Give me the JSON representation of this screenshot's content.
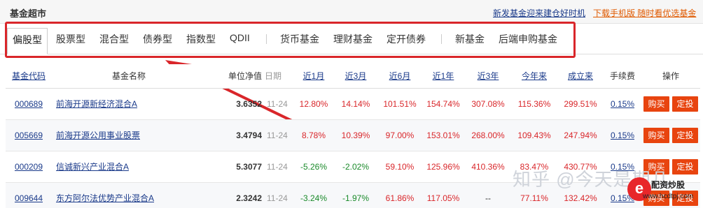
{
  "header": {
    "title": "基金超市",
    "link_new_fund": "新发基金迎来建仓好时机",
    "link_app": "下载手机版 随时看优选基金"
  },
  "tabs": [
    {
      "label": "偏股型"
    },
    {
      "label": "股票型"
    },
    {
      "label": "混合型"
    },
    {
      "label": "债券型"
    },
    {
      "label": "指数型"
    },
    {
      "label": "QDII"
    },
    {
      "label": "货币基金"
    },
    {
      "label": "理财基金"
    },
    {
      "label": "定开债券"
    },
    {
      "label": "新基金"
    },
    {
      "label": "后端申购基金"
    }
  ],
  "table": {
    "headers": {
      "code": "基金代码",
      "name": "基金名称",
      "nav": "单位净值",
      "date": "日期",
      "m1": "近1月",
      "m3": "近3月",
      "m6": "近6月",
      "y1": "近1年",
      "y3": "近3年",
      "ytd": "今年来",
      "since": "成立来",
      "fee": "手续费",
      "ops": "操作"
    },
    "rows": [
      {
        "code": "000689",
        "name": "前海开源新经济混合A",
        "nav": "3.6352",
        "date": "11-24",
        "m1": "12.80%",
        "m3": "14.14%",
        "m6": "101.51%",
        "y1": "154.74%",
        "y3": "307.08%",
        "ytd": "115.36%",
        "since": "299.51%",
        "fee": "0.15%"
      },
      {
        "code": "005669",
        "name": "前海开源公用事业股票",
        "nav": "3.4794",
        "date": "11-24",
        "m1": "8.78%",
        "m3": "10.39%",
        "m6": "97.00%",
        "y1": "153.01%",
        "y3": "268.00%",
        "ytd": "109.43%",
        "since": "247.94%",
        "fee": "0.15%"
      },
      {
        "code": "000209",
        "name": "信诚新兴产业混合A",
        "nav": "5.3077",
        "date": "11-24",
        "m1": "-5.26%",
        "m3": "-2.02%",
        "m6": "59.10%",
        "y1": "125.96%",
        "y3": "410.36%",
        "ytd": "83.47%",
        "since": "430.77%",
        "fee": "0.15%"
      },
      {
        "code": "009644",
        "name": "东方阿尔法优势产业混合A",
        "nav": "2.3242",
        "date": "11-24",
        "m1": "-3.24%",
        "m3": "-1.97%",
        "m6": "61.86%",
        "y1": "117.05%",
        "y3": "--",
        "ytd": "77.11%",
        "since": "132.42%",
        "fee": "0.15%"
      }
    ],
    "buy_label": "购买",
    "invest_label": "定投"
  },
  "watermark": {
    "text": "知乎 @今天是期几",
    "badge_logo": "e",
    "badge_title": "配资炒股",
    "badge_url": "www.hcdtpj.com"
  },
  "colors": {
    "positive": "#d9262a",
    "negative": "#1a8a2a",
    "link": "#1a3a8a",
    "button": "#e8440f",
    "highlight_box": "#d9262a"
  }
}
